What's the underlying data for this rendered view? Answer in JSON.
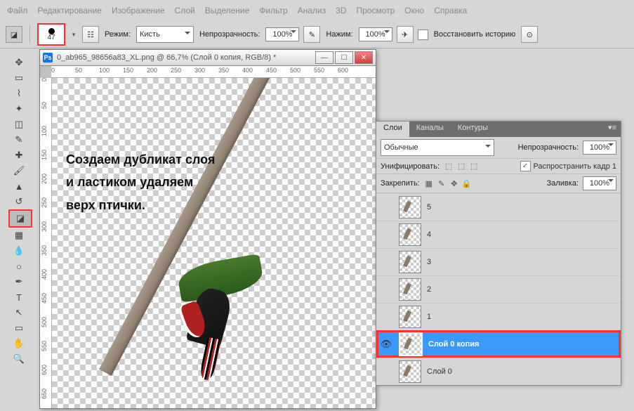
{
  "menu": [
    "Файл",
    "Редактирование",
    "Изображение",
    "Слой",
    "Выделение",
    "Фильтр",
    "Анализ",
    "3D",
    "Просмотр",
    "Окно",
    "Справка"
  ],
  "optbar": {
    "brush_size": "47",
    "mode_lbl": "Режим:",
    "mode_val": "Кисть",
    "opacity_lbl": "Непрозрачность:",
    "opacity_val": "100%",
    "flow_lbl": "Нажим:",
    "flow_val": "100%",
    "history_lbl": "Восстановить историю"
  },
  "doc": {
    "title": "0_ab965_98656a83_XL.png @ 66,7% (Слой 0 копия, RGB/8) *",
    "ruler_h": [
      "0",
      "50",
      "100",
      "150",
      "200",
      "250",
      "300",
      "350",
      "400",
      "450",
      "500",
      "550",
      "600"
    ],
    "ruler_v": [
      "0",
      "50",
      "100",
      "150",
      "200",
      "250",
      "300",
      "350",
      "400",
      "450",
      "500",
      "550",
      "600",
      "650"
    ]
  },
  "annotation": {
    "l1": "Создаем дубликат слоя",
    "l2": "и ластиком удаляем",
    "l3": "верх птички."
  },
  "layers_panel": {
    "tabs": [
      "Слои",
      "Каналы",
      "Контуры"
    ],
    "blend_val": "Обычные",
    "opacity_lbl": "Непрозрачность:",
    "opacity_val": "100%",
    "unify_lbl": "Унифицировать:",
    "propagate_lbl": "Распространить кадр 1",
    "lock_lbl": "Закрепить:",
    "fill_lbl": "Заливка:",
    "fill_val": "100%",
    "layers": [
      {
        "name": "5",
        "visible": false,
        "selected": false
      },
      {
        "name": "4",
        "visible": false,
        "selected": false
      },
      {
        "name": "3",
        "visible": false,
        "selected": false
      },
      {
        "name": "2",
        "visible": false,
        "selected": false
      },
      {
        "name": "1",
        "visible": false,
        "selected": false
      },
      {
        "name": "Слой 0 копия",
        "visible": true,
        "selected": true
      },
      {
        "name": "Слой 0",
        "visible": false,
        "selected": false
      }
    ]
  }
}
